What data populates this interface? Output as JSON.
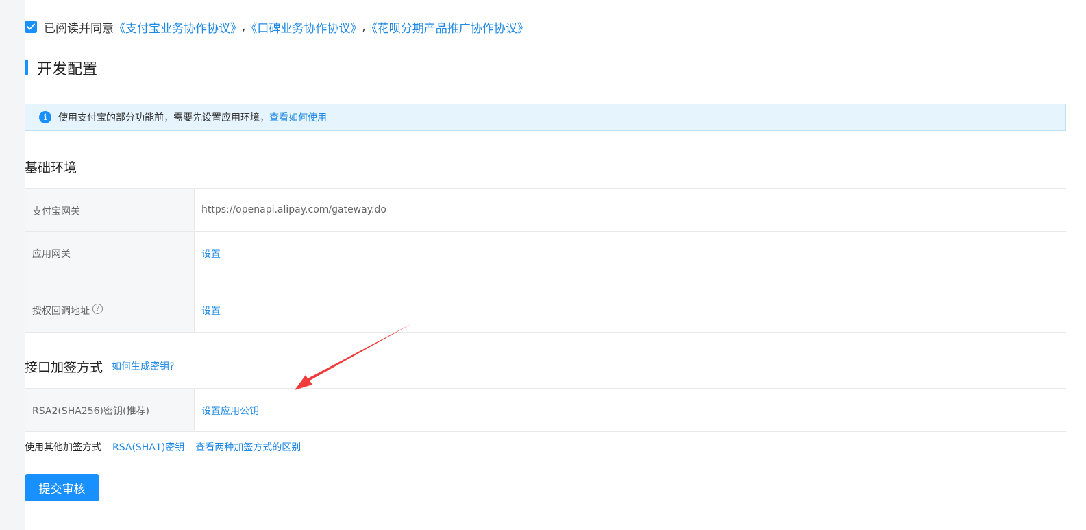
{
  "agreement": {
    "prefix": "已阅读并同意",
    "links": [
      "《支付宝业务协作协议》",
      "《口碑业务协作协议》",
      "《花呗分期产品推广协作协议》"
    ],
    "separator": ","
  },
  "section": {
    "title": "开发配置"
  },
  "banner": {
    "text": "使用支付宝的部分功能前，需要先设置应用环境，",
    "link": "查看如何使用"
  },
  "basic_env": {
    "heading": "基础环境",
    "rows": [
      {
        "label": "支付宝网关",
        "value": "https://openapi.alipay.com/gateway.do"
      },
      {
        "label": "应用网关",
        "value": "设置"
      },
      {
        "label": "授权回调地址",
        "value": "设置"
      }
    ]
  },
  "signing": {
    "heading": "接口加签方式",
    "help_link": "如何生成密钥?",
    "rows": [
      {
        "label": "RSA2(SHA256)密钥(推荐)",
        "value": "设置应用公钥"
      }
    ],
    "other_label": "使用其他加签方式",
    "other_link": "RSA(SHA1)密钥",
    "diff_link": "查看两种加签方式的区别"
  },
  "submit": {
    "label": "提交审核"
  },
  "colors": {
    "accent": "#1890ff",
    "link": "#1e88e5",
    "arrow": "#f03c3c"
  },
  "icons": {
    "checkbox": "checkbox-checked-icon",
    "info": "info-icon",
    "question": "question-circle-icon",
    "arrow": "red-arrow-annotation"
  }
}
